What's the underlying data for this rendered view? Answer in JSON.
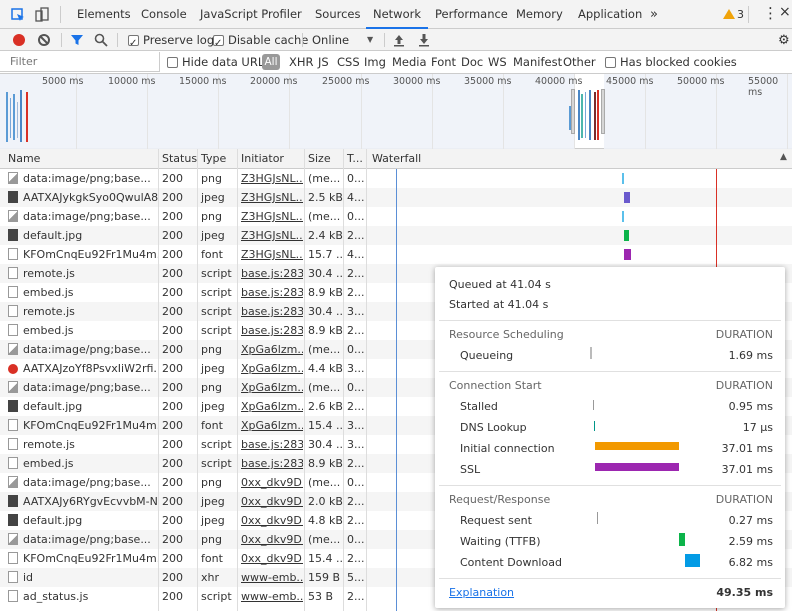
{
  "tabs": {
    "items": [
      "Elements",
      "Console",
      "JavaScript Profiler",
      "Sources",
      "Network",
      "Performance",
      "Memory",
      "Application"
    ],
    "more": "»",
    "warnings_count": "3",
    "active": "Network"
  },
  "toolbar": {
    "preserve_log": "Preserve log",
    "disable_cache": "Disable cache",
    "throttling": "Online"
  },
  "filter": {
    "placeholder": "Filter",
    "hide_data_urls": "Hide data URLs",
    "types": [
      "All",
      "XHR",
      "JS",
      "CSS",
      "Img",
      "Media",
      "Font",
      "Doc",
      "WS",
      "Manifest",
      "Other"
    ],
    "has_blocked_cookies": "Has blocked cookies"
  },
  "overview": {
    "ticks": [
      "5000 ms",
      "10000 ms",
      "15000 ms",
      "20000 ms",
      "25000 ms",
      "30000 ms",
      "35000 ms",
      "40000 ms",
      "45000 ms",
      "50000 ms",
      "55000 ms"
    ]
  },
  "columns": [
    "Name",
    "Status",
    "Type",
    "Initiator",
    "Size",
    "T...",
    "Waterfall"
  ],
  "rows": [
    {
      "name": "data:image/png;base...",
      "status": "200",
      "type": "png",
      "initiator": "Z3HGJsNL...",
      "size": "(me...",
      "time": "0...",
      "icon": "data"
    },
    {
      "name": "AATXAJykgkSyo0QwulA8...",
      "status": "200",
      "type": "jpeg",
      "initiator": "Z3HGJsNL...",
      "size": "2.5 kB",
      "time": "4...",
      "icon": "img"
    },
    {
      "name": "data:image/png;base...",
      "status": "200",
      "type": "png",
      "initiator": "Z3HGJsNL...",
      "size": "(me...",
      "time": "0...",
      "icon": "data"
    },
    {
      "name": "default.jpg",
      "status": "200",
      "type": "jpeg",
      "initiator": "Z3HGJsNL...",
      "size": "2.4 kB",
      "time": "2...",
      "icon": "img"
    },
    {
      "name": "KFOmCnqEu92Fr1Mu4m...",
      "status": "200",
      "type": "font",
      "initiator": "Z3HGJsNL...",
      "size": "15.7 ...",
      "time": "4...",
      "icon": "doc"
    },
    {
      "name": "remote.js",
      "status": "200",
      "type": "script",
      "initiator": "base.js:2831",
      "size": "30.4 ...",
      "time": "2...",
      "icon": "doc"
    },
    {
      "name": "embed.js",
      "status": "200",
      "type": "script",
      "initiator": "base.js:2831",
      "size": "8.9 kB",
      "time": "2...",
      "icon": "doc"
    },
    {
      "name": "remote.js",
      "status": "200",
      "type": "script",
      "initiator": "base.js:2831",
      "size": "30.4 ...",
      "time": "3...",
      "icon": "doc"
    },
    {
      "name": "embed.js",
      "status": "200",
      "type": "script",
      "initiator": "base.js:2831",
      "size": "8.9 kB",
      "time": "2...",
      "icon": "doc"
    },
    {
      "name": "data:image/png;base...",
      "status": "200",
      "type": "png",
      "initiator": "XpGa6lzm...",
      "size": "(me...",
      "time": "0...",
      "icon": "data"
    },
    {
      "name": "AATXAJzoYf8PsvxIiW2rfi...",
      "status": "200",
      "type": "jpeg",
      "initiator": "XpGa6lzm...",
      "size": "4.4 kB",
      "time": "3...",
      "icon": "red"
    },
    {
      "name": "data:image/png;base...",
      "status": "200",
      "type": "png",
      "initiator": "XpGa6lzm...",
      "size": "(me...",
      "time": "0...",
      "icon": "data"
    },
    {
      "name": "default.jpg",
      "status": "200",
      "type": "jpeg",
      "initiator": "XpGa6lzm...",
      "size": "2.6 kB",
      "time": "2...",
      "icon": "img"
    },
    {
      "name": "KFOmCnqEu92Fr1Mu4m...",
      "status": "200",
      "type": "font",
      "initiator": "XpGa6lzm...",
      "size": "15.4 ...",
      "time": "3...",
      "icon": "doc"
    },
    {
      "name": "remote.js",
      "status": "200",
      "type": "script",
      "initiator": "base.js:2831",
      "size": "30.4 ...",
      "time": "3...",
      "icon": "doc"
    },
    {
      "name": "embed.js",
      "status": "200",
      "type": "script",
      "initiator": "base.js:2831",
      "size": "8.9 kB",
      "time": "2...",
      "icon": "doc"
    },
    {
      "name": "data:image/png;base...",
      "status": "200",
      "type": "png",
      "initiator": "0xx_dkv9D...",
      "size": "(me...",
      "time": "0...",
      "icon": "data"
    },
    {
      "name": "AATXAJy6RYgvEcvvbM-N...",
      "status": "200",
      "type": "jpeg",
      "initiator": "0xx_dkv9D...",
      "size": "2.0 kB",
      "time": "2...",
      "icon": "img"
    },
    {
      "name": "default.jpg",
      "status": "200",
      "type": "jpeg",
      "initiator": "0xx_dkv9D...",
      "size": "4.8 kB",
      "time": "2...",
      "icon": "img"
    },
    {
      "name": "data:image/png;base...",
      "status": "200",
      "type": "png",
      "initiator": "0xx_dkv9D...",
      "size": "(me...",
      "time": "0...",
      "icon": "data"
    },
    {
      "name": "KFOmCnqEu92Fr1Mu4m...",
      "status": "200",
      "type": "font",
      "initiator": "0xx_dkv9D...",
      "size": "15.4 ...",
      "time": "2...",
      "icon": "doc"
    },
    {
      "name": "id",
      "status": "200",
      "type": "xhr",
      "initiator": "www-emb...",
      "size": "159 B",
      "time": "5...",
      "icon": "doc"
    },
    {
      "name": "ad_status.js",
      "status": "200",
      "type": "script",
      "initiator": "www-emb...",
      "size": "53 B",
      "time": "2...",
      "icon": "doc"
    }
  ],
  "timing": {
    "queued_at": "Queued at 41.04 s",
    "started_at": "Started at 41.04 s",
    "duration_label": "DURATION",
    "resource_scheduling": "Resource Scheduling",
    "queueing": "Queueing",
    "queueing_val": "1.69 ms",
    "connection_start": "Connection Start",
    "stalled": "Stalled",
    "stalled_val": "0.95 ms",
    "dns": "DNS Lookup",
    "dns_val": "17 μs",
    "initial_connection": "Initial connection",
    "initial_connection_val": "37.01 ms",
    "ssl": "SSL",
    "ssl_val": "37.01 ms",
    "request_response": "Request/Response",
    "request_sent": "Request sent",
    "request_sent_val": "0.27 ms",
    "waiting": "Waiting (TTFB)",
    "waiting_val": "2.59 ms",
    "content_download": "Content Download",
    "content_download_val": "6.82 ms",
    "explanation": "Explanation",
    "total": "49.35 ms"
  },
  "colors": {
    "accent": "#1a73e8",
    "record": "#d93025",
    "initial_connection": "#f29900",
    "ssl": "#9c27b0",
    "waiting": "#0cb44a",
    "content_download": "#039be5",
    "dns": "#009688"
  }
}
